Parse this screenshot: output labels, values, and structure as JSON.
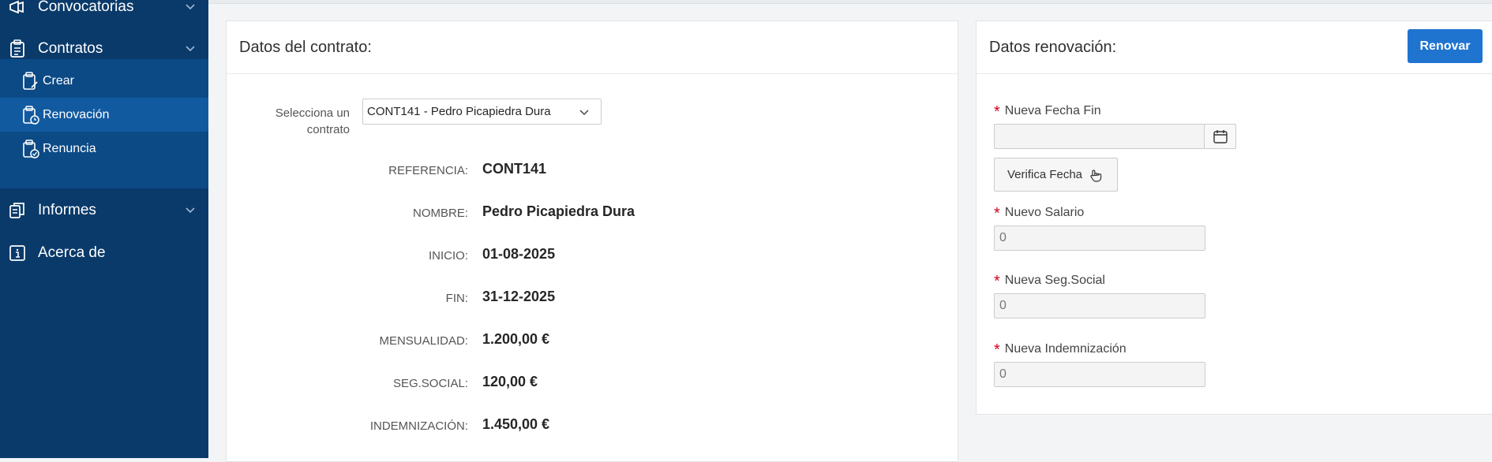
{
  "sidebar": {
    "items": [
      {
        "label": "Convocatorias",
        "icon": "megaphone-icon"
      },
      {
        "label": "Contratos",
        "icon": "clipboard-icon"
      },
      {
        "label": "Informes",
        "icon": "documents-icon"
      },
      {
        "label": "Acerca de",
        "icon": "info-icon"
      }
    ],
    "subitems": [
      {
        "label": "Crear",
        "icon": "clipboard-edit-icon"
      },
      {
        "label": "Renovación",
        "icon": "clipboard-clock-icon"
      },
      {
        "label": "Renuncia",
        "icon": "clipboard-check-icon"
      }
    ]
  },
  "contract": {
    "title": "Datos del contrato:",
    "select_label": "Selecciona un contrato",
    "select_value": "CONT141 - Pedro Picapiedra Dura",
    "fields": [
      {
        "key": "REFERENCIA:",
        "value": "CONT141"
      },
      {
        "key": "NOMBRE:",
        "value": "Pedro Picapiedra Dura"
      },
      {
        "key": "INICIO:",
        "value": "01-08-2025"
      },
      {
        "key": "FIN:",
        "value": "31-12-2025"
      },
      {
        "key": "MENSUALIDAD:",
        "value": "1.200,00 €"
      },
      {
        "key": "SEG.SOCIAL:",
        "value": "120,00 €"
      },
      {
        "key": "INDEMNIZACIÓN:",
        "value": "1.450,00 €"
      }
    ]
  },
  "renewal": {
    "title": "Datos renovación:",
    "renew_button": "Renovar",
    "fecha_label": "Nueva Fecha Fin",
    "fecha_value": "",
    "verify_button": "Verifica Fecha",
    "salario_label": "Nuevo Salario",
    "salario_value": "0",
    "seg_label": "Nueva Seg.Social",
    "seg_value": "0",
    "indem_label": "Nueva Indemnización",
    "indem_value": "0",
    "required_mark": "*"
  },
  "colors": {
    "sidebar": "#0a3a6a",
    "accent": "#1f74d0",
    "required": "#d0021b"
  }
}
